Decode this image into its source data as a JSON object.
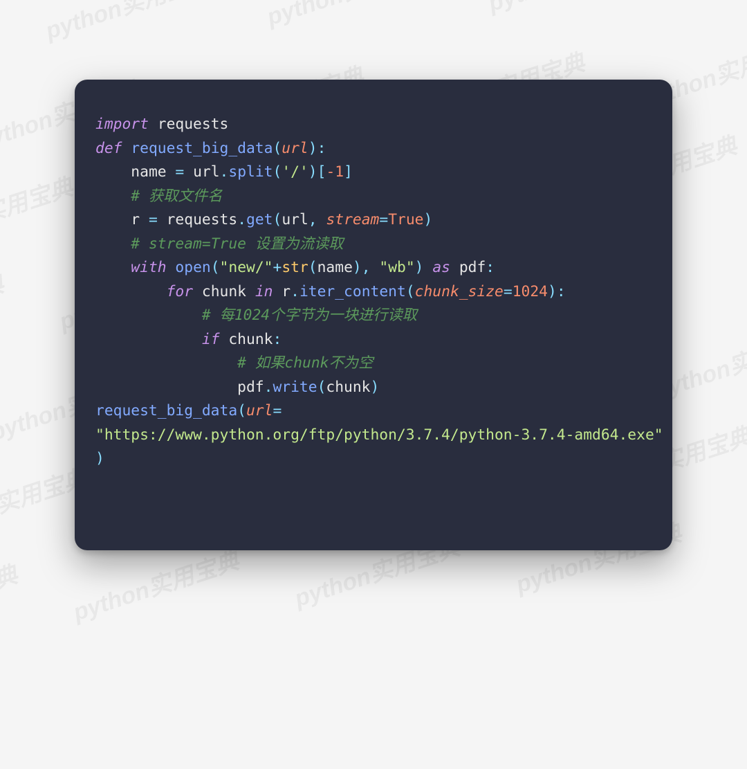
{
  "watermark_text": "python实用宝典",
  "code": {
    "line1": {
      "import": "import",
      "module": "requests"
    },
    "line2": {
      "def": "def",
      "name": "request_big_data",
      "arg": "url"
    },
    "line3": {
      "lhs": "name",
      "eq": "=",
      "url": "url",
      "dot": ".",
      "split": "split",
      "s": "'/'",
      "idx": "-1"
    },
    "line4": {
      "comment": "# 获取文件名"
    },
    "line5": {
      "lhs": "r",
      "eq": "=",
      "mod": "requests",
      "dot": ".",
      "get": "get",
      "url": "url",
      "kw": "stream",
      "eqk": "=",
      "val": "True"
    },
    "line6": {
      "comment": "# stream=True 设置为流读取"
    },
    "line7": {
      "with": "with",
      "open": "open",
      "s1": "\"new/\"",
      "plus": "+",
      "str": "str",
      "name": "name",
      "s2": "\"wb\"",
      "as": "as",
      "pdf": "pdf"
    },
    "line8": {
      "for": "for",
      "chunk": "chunk",
      "in": "in",
      "r": "r",
      "dot": ".",
      "iter": "iter_content",
      "kw": "chunk_size",
      "eqk": "=",
      "val": "1024"
    },
    "line9": {
      "comment": "# 每1024个字节为一块进行读取"
    },
    "line10": {
      "if": "if",
      "chunk": "chunk"
    },
    "line11": {
      "comment": "# 如果chunk不为空"
    },
    "line12": {
      "pdf": "pdf",
      "dot": ".",
      "write": "write",
      "chunk": "chunk"
    },
    "line13": {
      "call": "request_big_data",
      "kw": "url",
      "eqk": "="
    },
    "line14": {
      "url": "\"https://www.python.org/ftp/python/3.7.4/python-3.7.4-amd64.exe\""
    }
  }
}
